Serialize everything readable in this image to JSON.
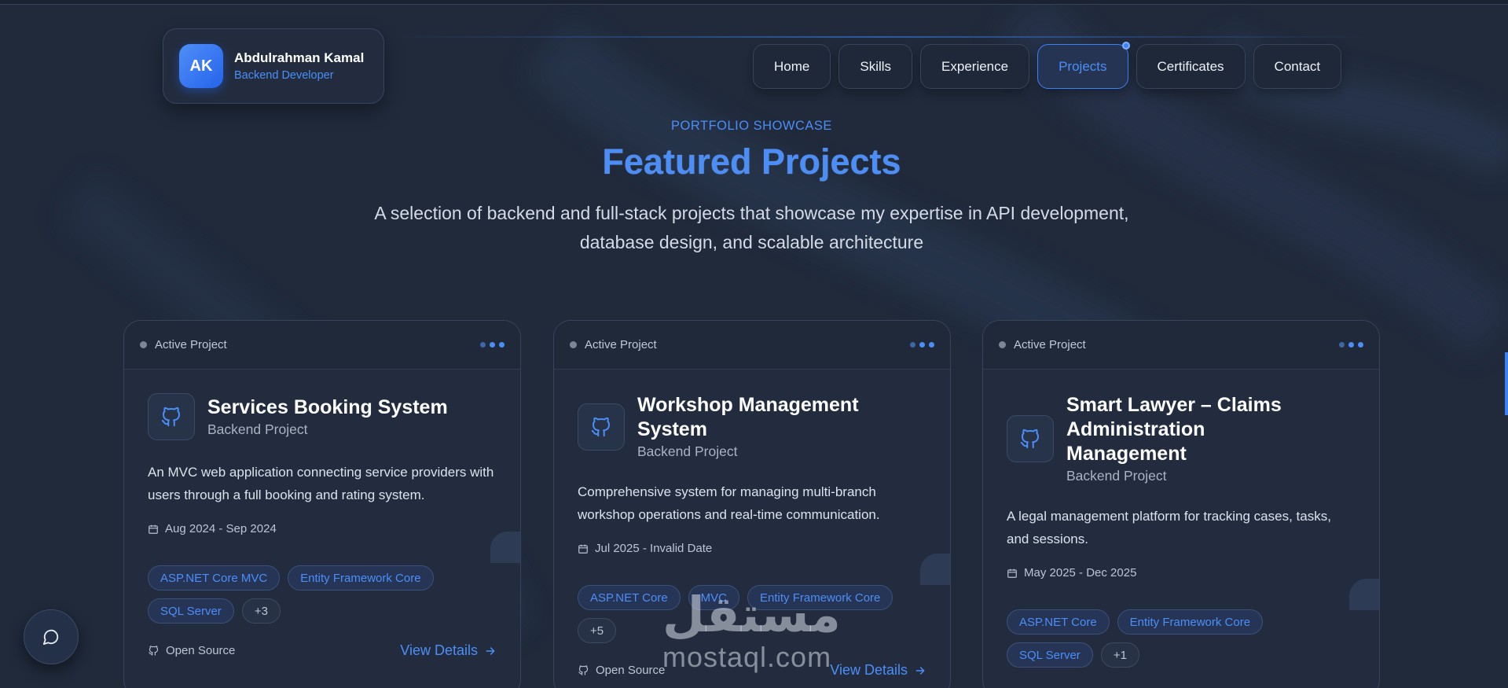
{
  "brand": {
    "initials": "AK",
    "name": "Abdulrahman Kamal",
    "role": "Backend Developer"
  },
  "nav": [
    {
      "label": "Home",
      "active": false
    },
    {
      "label": "Skills",
      "active": false
    },
    {
      "label": "Experience",
      "active": false
    },
    {
      "label": "Projects",
      "active": true
    },
    {
      "label": "Certificates",
      "active": false
    },
    {
      "label": "Contact",
      "active": false
    }
  ],
  "hero": {
    "eyebrow": "PORTFOLIO SHOWCASE",
    "title": "Featured Projects",
    "subtitle": "A selection of backend and full-stack projects that showcase my expertise in API development, database design, and scalable architecture"
  },
  "projects": [
    {
      "status": "Active Project",
      "title": "Services Booking System",
      "kind": "Backend Project",
      "desc": "An MVC web application connecting service providers with users through a full booking and rating system.",
      "date": "Aug 2024 - Sep 2024",
      "tags": [
        "ASP.NET Core MVC",
        "Entity Framework Core",
        "SQL Server"
      ],
      "more": "+3",
      "open_source": "Open Source",
      "view": "View Details"
    },
    {
      "status": "Active Project",
      "title": "Workshop Management System",
      "kind": "Backend Project",
      "desc": "Comprehensive system for managing multi-branch workshop operations and real-time communication.",
      "date": "Jul 2025 - Invalid Date",
      "tags": [
        "ASP.NET Core",
        "MVC",
        "Entity Framework Core"
      ],
      "more": "+5",
      "open_source": "Open Source",
      "view": "View Details"
    },
    {
      "status": "Active Project",
      "title": "Smart Lawyer – Claims Administration Management",
      "kind": "Backend Project",
      "desc": "A legal management platform for tracking cases, tasks, and sessions.",
      "date": "May 2025 - Dec 2025",
      "tags": [
        "ASP.NET Core",
        "Entity Framework Core",
        "SQL Server"
      ],
      "more": "+1",
      "open_source": "",
      "view": ""
    }
  ],
  "watermark": {
    "arabic": "مستقل",
    "latin": "mostaql.com"
  },
  "colors": {
    "accent": "#3b82f6",
    "background": "#202a3b",
    "card": "#222c3e"
  },
  "icons": {
    "chat": "chat-bubble-icon",
    "project": "github-icon",
    "calendar": "calendar-icon",
    "arrow": "arrow-right-icon"
  }
}
